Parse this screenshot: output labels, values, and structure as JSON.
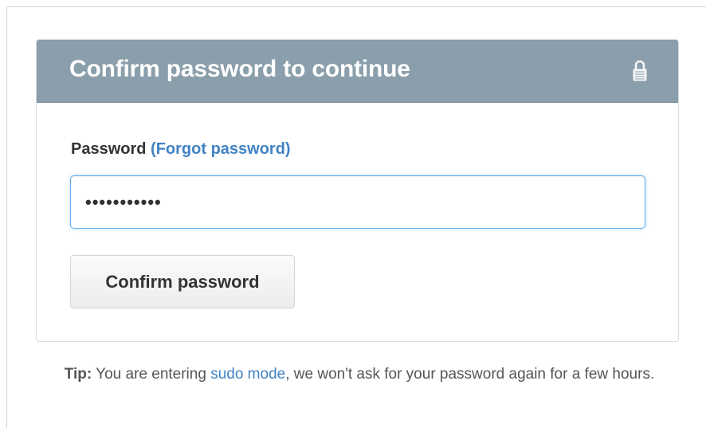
{
  "panel": {
    "title": "Confirm password to continue",
    "header_icon": "lock-icon",
    "header_bg_color": "#8a9eab"
  },
  "form": {
    "password_label": "Password",
    "forgot_link": "(Forgot password)",
    "password_value": "•••••••••••",
    "submit_label": "Confirm password"
  },
  "tip": {
    "label": "Tip:",
    "text_before": " You are entering ",
    "link": "sudo mode",
    "text_after": ", we won't ask for your password again for a few hours."
  },
  "colors": {
    "link": "#4183c4",
    "focus_border": "#66aff0"
  }
}
